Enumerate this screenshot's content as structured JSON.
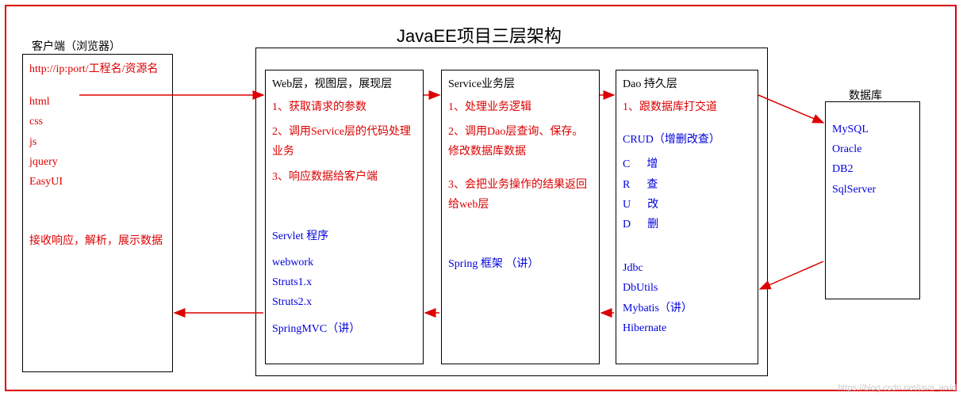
{
  "title": "JavaEE项目三层架构",
  "client": {
    "heading": "客户端（浏览器）",
    "url": "http://ip:port/工程名/资源名",
    "techs": [
      "html",
      "css",
      "js",
      "jquery",
      "EasyUI"
    ],
    "receive": "接收响应，解析，展示数据"
  },
  "web": {
    "heading": "Web层，视图层，展现层",
    "step1": "1、获取请求的参数",
    "step2": "2、调用Service层的代码处理业务",
    "step3": "3、响应数据给客户端",
    "frameworks": [
      "Servlet 程序",
      "webwork",
      "Struts1.x",
      "Struts2.x",
      "SpringMVC（讲）"
    ]
  },
  "service": {
    "heading": "Service业务层",
    "step1": "1、处理业务逻辑",
    "step2": "2、调用Dao层查询、保存。修改数据库数据",
    "step3": "3、会把业务操作的结果返回给web层",
    "frameworks": [
      "Spring 框架 （讲）"
    ]
  },
  "dao": {
    "heading": "Dao 持久层",
    "step1": "1、跟数据库打交道",
    "crud": "CRUD（增删改查）",
    "crud_lines": [
      "C      增",
      "R      查",
      "U      改",
      "D      删"
    ],
    "frameworks": [
      "Jdbc",
      "DbUtils",
      "Mybatis（讲）",
      "Hibernate"
    ]
  },
  "db": {
    "heading": "数据库",
    "items": [
      "MySQL",
      "Oracle",
      "DB2",
      "SqlServer"
    ]
  },
  "watermark": "https://blog.csdn.net/java_wxid",
  "colors": {
    "red": "#d00",
    "blue": "#00d"
  }
}
